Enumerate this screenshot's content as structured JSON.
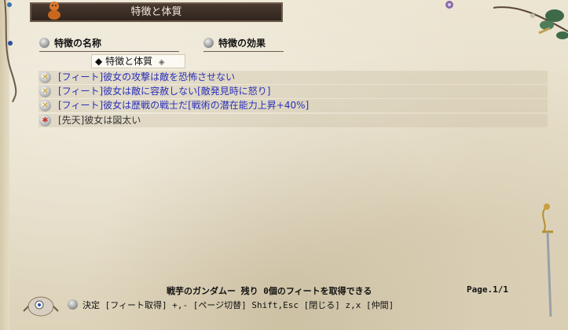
{
  "window": {
    "title": "特徴と体質"
  },
  "columns": {
    "name": "特徴の名称",
    "effect": "特徴の効果"
  },
  "filter": {
    "selected": "特徴と体質",
    "bullet": "◆"
  },
  "features": [
    {
      "type": "feat",
      "icon": "feat-icon",
      "label": "[フィート]彼女の攻撃は敵を恐怖させない"
    },
    {
      "type": "feat",
      "icon": "feat-icon",
      "label": "[フィート]彼女は敵に容赦しない[敵発見時に怒り]"
    },
    {
      "type": "feat",
      "icon": "feat-icon",
      "label": "[フィート]彼女は歴戦の戦士だ[戦術の潜在能力上昇+40%]"
    },
    {
      "type": "innate",
      "icon": "innate-icon",
      "label": "[先天]彼女は図太い"
    }
  ],
  "status": {
    "remaining": "戦芋のガンダムー 残り 0個のフィートを取得できる",
    "page": "Page.1/1"
  },
  "footer": {
    "hint": "決定 [フィート取得]  +,- [ページ切替]  Shift,Esc [閉じる]  z,x [仲間]"
  },
  "colors": {
    "title_bg": "#3a2e26",
    "feat_text": "#2a30b8",
    "innate_text": "#333333",
    "parchment": "#e8e0cc"
  }
}
